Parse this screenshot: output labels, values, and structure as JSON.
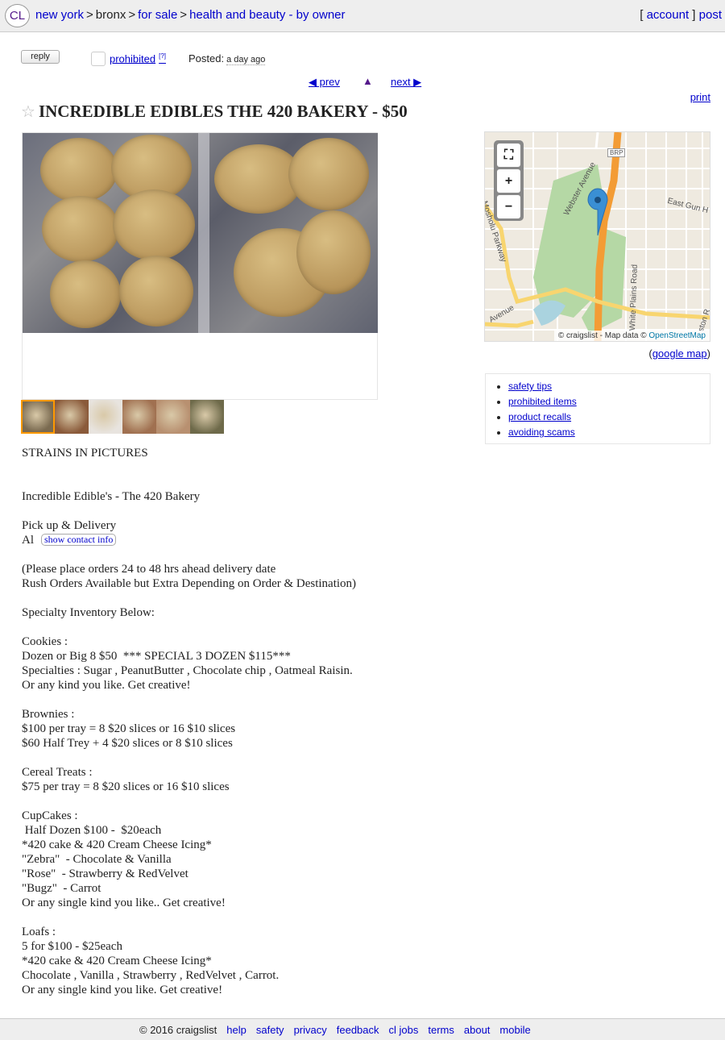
{
  "header": {
    "logo": "CL",
    "breadcrumbs": [
      {
        "label": "new york",
        "link": true
      },
      {
        "label": "bronx",
        "link": false
      },
      {
        "label": "for sale",
        "link": true
      },
      {
        "label": "health and beauty - by owner",
        "link": true
      }
    ],
    "account": "account",
    "post": "post"
  },
  "postinfo": {
    "reply": "reply",
    "prohibited": "prohibited",
    "prohibited_sup": "[?]",
    "posted_label": "Posted:",
    "posted_ago": "a day ago"
  },
  "nav": {
    "prev": "◀ prev",
    "up": "▲",
    "next": "next ▶",
    "print": "print"
  },
  "title": {
    "star": "☆",
    "text": "INCREDIBLE EDIBLES THE 420 BAKERY - $50"
  },
  "thumbnails": [
    {
      "name": "thumb-1",
      "selected": true,
      "color": "#7a6a50"
    },
    {
      "name": "thumb-2",
      "selected": false,
      "color": "#8a5a3a"
    },
    {
      "name": "thumb-3",
      "selected": false,
      "color": "#e8e4df"
    },
    {
      "name": "thumb-4",
      "selected": false,
      "color": "#a07050"
    },
    {
      "name": "thumb-5",
      "selected": false,
      "color": "#b89070"
    },
    {
      "name": "thumb-6",
      "selected": false,
      "color": "#6e6a4a"
    }
  ],
  "map": {
    "labels": [
      "BRP",
      "Webster Avenue",
      "Mosholu Parkway",
      "East Gun H",
      "White Plains Road",
      "Avenue",
      "ston R"
    ],
    "attribution_prefix": "© craigslist - Map data ©",
    "attribution_link": "OpenStreetMap",
    "google_map_open": "(",
    "google_map": "google map",
    "google_map_close": ")"
  },
  "safety_links": [
    "safety tips",
    "prohibited items",
    "product recalls",
    "avoiding scams"
  ],
  "body": {
    "line1": "STRAINS IN PICTURES",
    "line2": "Incredible Edible's - The 420 Bakery",
    "line3": "Pick up & Delivery",
    "contact_name": "Al",
    "contact_button": "show contact info",
    "line4": "(Please place orders 24 to 48 hrs ahead delivery date",
    "line5": "Rush Orders Available but Extra Depending on Order & Destination)",
    "line6": "Specialty Inventory Below:",
    "line7": "Cookies :",
    "line8": "Dozen or Big 8 $50  *** SPECIAL 3 DOZEN $115***",
    "line9": "Specialties : Sugar , PeanutButter , Chocolate chip , Oatmeal Raisin.",
    "line10": "Or any kind you like. Get creative!",
    "line11": "Brownies :",
    "line12": "$100 per tray = 8 $20 slices or 16 $10 slices",
    "line13": "$60 Half Trey + 4 $20 slices or 8 $10 slices",
    "line14": "Cereal Treats :",
    "line15": "$75 per tray = 8 $20 slices or 16 $10 slices",
    "line16": "CupCakes :",
    "line17": " Half Dozen $100 -  $20each",
    "line18": "*420 cake & 420 Cream Cheese Icing*",
    "line19": "\"Zebra\"  - Chocolate & Vanilla",
    "line20": "\"Rose\"  - Strawberry & RedVelvet",
    "line21": "\"Bugz\"  - Carrot",
    "line22": "Or any single kind you like.. Get creative!",
    "line23": "Loafs :",
    "line24": "5 for $100 - $25each",
    "line25": "*420 cake & 420 Cream Cheese Icing*",
    "line26": "Chocolate , Vanilla , Strawberry , RedVelvet , Carrot.",
    "line27": "Or any single kind you like. Get creative!"
  },
  "footer": {
    "copyright": "© 2016 craigslist",
    "links": [
      "help",
      "safety",
      "privacy",
      "feedback",
      "cl jobs",
      "terms",
      "about",
      "mobile"
    ]
  }
}
